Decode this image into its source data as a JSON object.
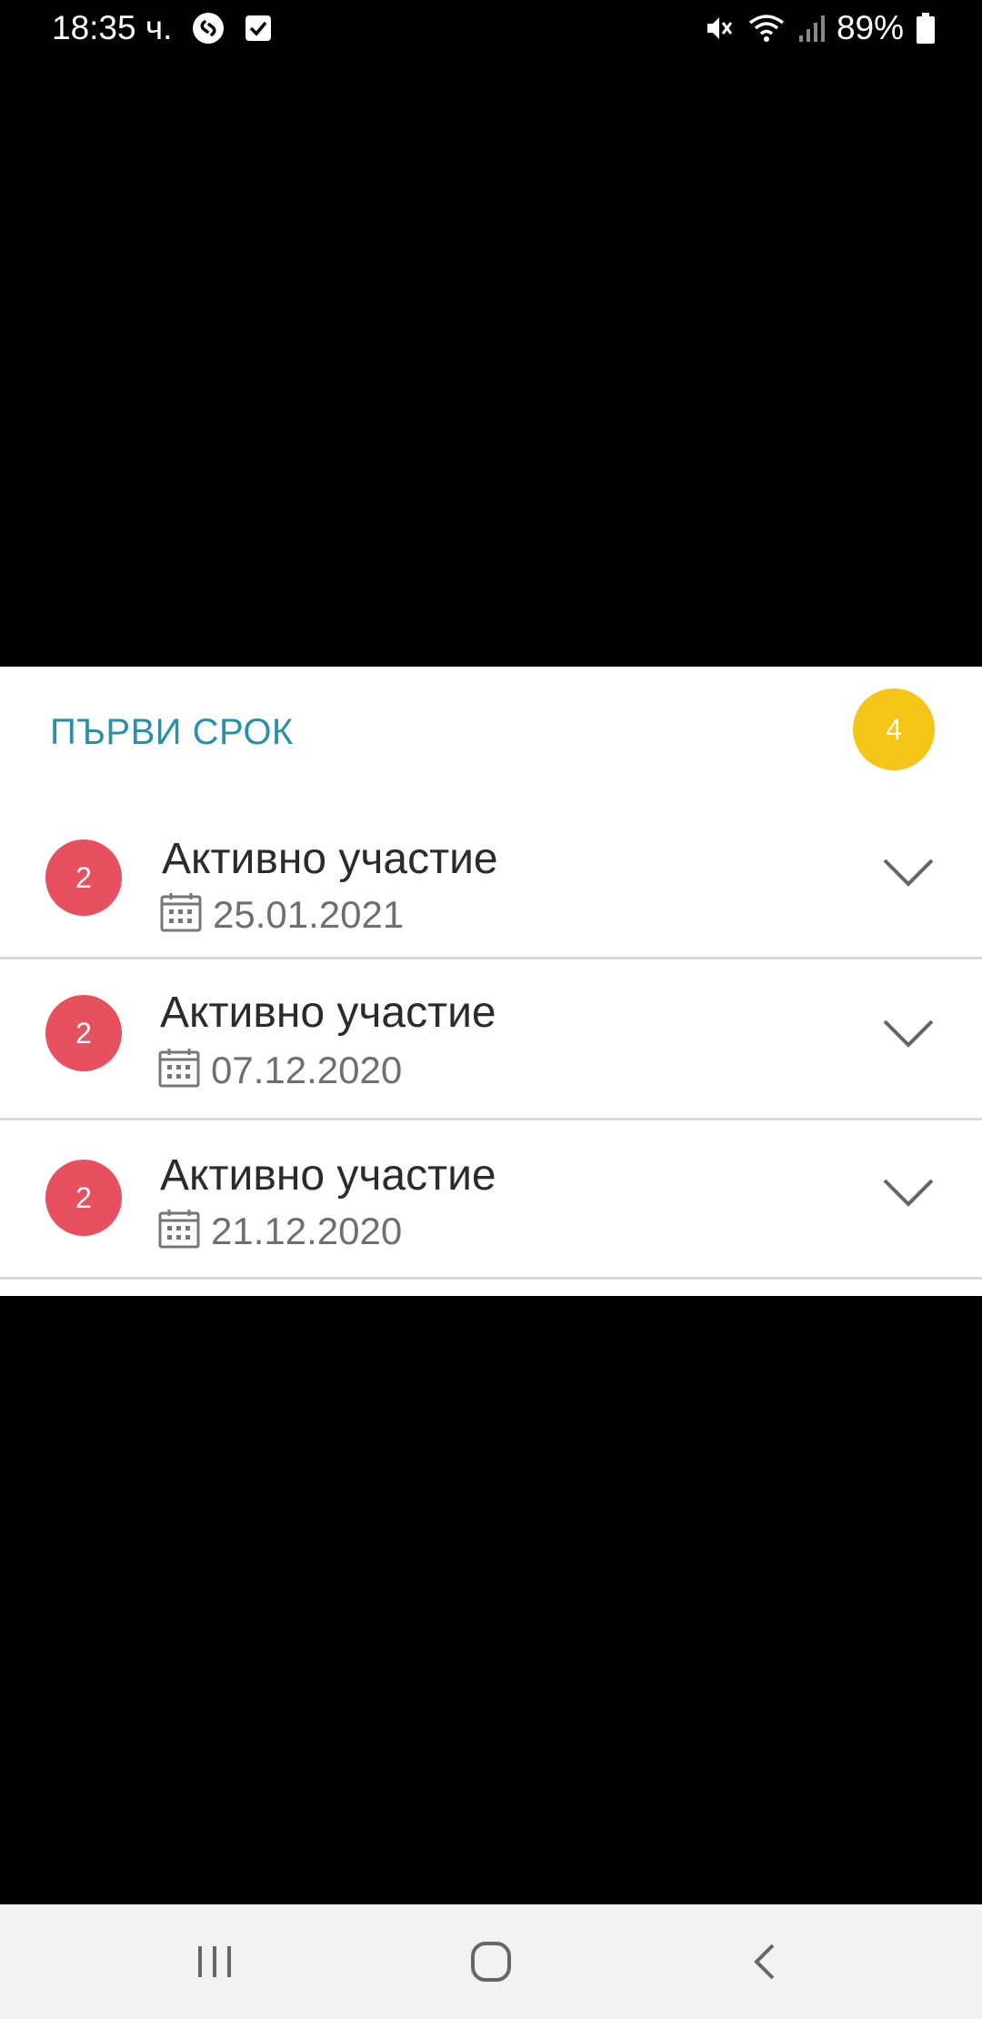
{
  "status_bar": {
    "time": "18:35 ч.",
    "battery": "89%",
    "icons": [
      "shazam-icon",
      "checkbox-notification-icon",
      "mute-icon",
      "wifi-icon",
      "signal-icon",
      "battery-icon"
    ]
  },
  "section": {
    "title": "ПЪРВИ СРОК",
    "count": "4"
  },
  "items": [
    {
      "badge": "2",
      "title": "Активно участие",
      "date": "25.01.2021"
    },
    {
      "badge": "2",
      "title": "Активно участие",
      "date": "07.12.2020"
    },
    {
      "badge": "2",
      "title": "Активно участие",
      "date": "21.12.2020"
    }
  ],
  "colors": {
    "section_title": "#2a8fa8",
    "count_badge": "#f5c518",
    "item_badge": "#e7505e"
  },
  "nav": [
    "recent-apps-icon",
    "home-icon",
    "back-icon"
  ]
}
